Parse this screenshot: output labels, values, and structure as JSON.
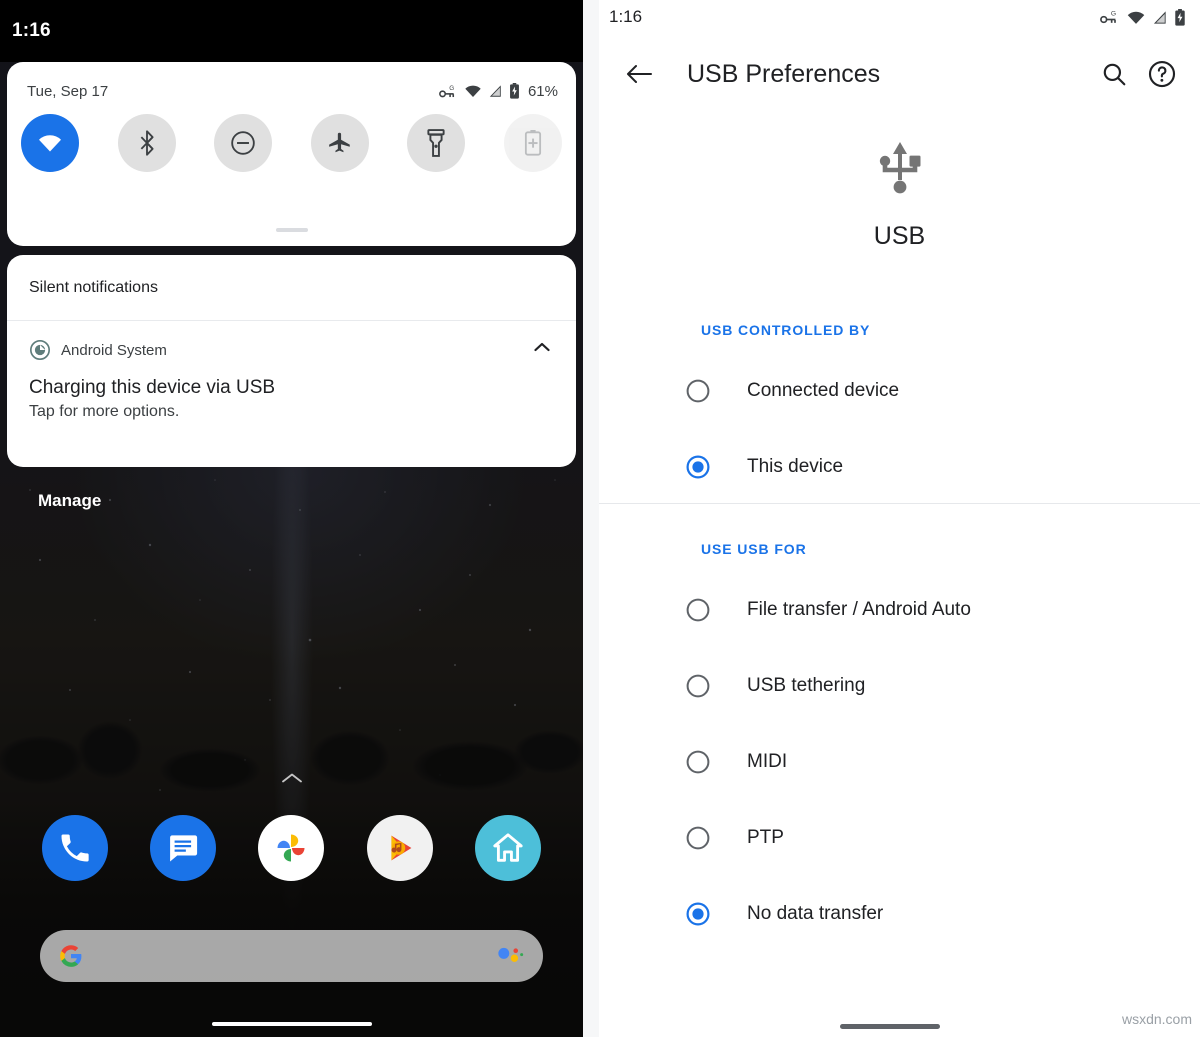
{
  "left_phone": {
    "status_bar": {
      "clock": "1:16",
      "icons": [
        "vpn-key-g-icon",
        "wifi-icon",
        "cell-signal-icon",
        "battery-charging-icon"
      ]
    },
    "quick_settings": {
      "date": "Tue, Sep 17",
      "battery_percent": "61%",
      "status_icons": [
        "vpn-key-g-icon",
        "wifi-icon",
        "cell-signal-icon",
        "battery-charging-icon"
      ],
      "tiles": [
        {
          "name": "wifi",
          "label": "Wi-Fi",
          "icon": "wifi-icon",
          "state": "on"
        },
        {
          "name": "bluetooth",
          "label": "Bluetooth",
          "icon": "bluetooth-icon",
          "state": "off"
        },
        {
          "name": "dnd",
          "label": "Do Not Disturb",
          "icon": "do-not-disturb-icon",
          "state": "off"
        },
        {
          "name": "airplane",
          "label": "Airplane mode",
          "icon": "airplane-icon",
          "state": "off"
        },
        {
          "name": "flashlight",
          "label": "Flashlight",
          "icon": "flashlight-icon",
          "state": "off"
        },
        {
          "name": "battery-saver",
          "label": "Battery Saver",
          "icon": "battery-saver-icon",
          "state": "disabled"
        }
      ]
    },
    "notifications": {
      "section_title": "Silent notifications",
      "items": [
        {
          "app_name": "Android System",
          "app_icon": "android-system-icon",
          "title": "Charging this device via USB",
          "text": "Tap for more options.",
          "collapse_icon": "chevron-up-icon"
        }
      ],
      "manage_label": "Manage"
    },
    "dock": [
      {
        "name": "phone",
        "label": "Phone",
        "color": "#1a73e8"
      },
      {
        "name": "messages",
        "label": "Messages",
        "color": "#1a73e8"
      },
      {
        "name": "photos",
        "label": "Photos",
        "color": "#ffffff"
      },
      {
        "name": "play-music",
        "label": "Play Music",
        "color": "#f1f1f1"
      },
      {
        "name": "google-home",
        "label": "Google Home",
        "color": "#4dbfd9"
      }
    ],
    "search_bar": {
      "google_logo": "google-g-icon",
      "assistant_icon": "google-assistant-icon",
      "placeholder": ""
    }
  },
  "right_settings": {
    "status_bar": {
      "clock": "1:16",
      "icons": [
        "vpn-key-g-icon",
        "wifi-icon",
        "cell-signal-icon",
        "battery-charging-icon"
      ]
    },
    "toolbar": {
      "back_icon": "arrow-back-icon",
      "title": "USB Preferences",
      "search_icon": "search-icon",
      "help_icon": "help-circle-icon"
    },
    "hero": {
      "icon": "usb-icon",
      "label": "USB"
    },
    "sections": [
      {
        "header": "USB CONTROLLED BY",
        "options": [
          {
            "label": "Connected device",
            "selected": false
          },
          {
            "label": "This device",
            "selected": true
          }
        ]
      },
      {
        "header": "USE USB FOR",
        "options": [
          {
            "label": "File transfer / Android Auto",
            "selected": false
          },
          {
            "label": "USB tethering",
            "selected": false
          },
          {
            "label": "MIDI",
            "selected": false
          },
          {
            "label": "PTP",
            "selected": false
          },
          {
            "label": "No data transfer",
            "selected": true
          }
        ]
      }
    ]
  },
  "watermark": "wsxdn.com",
  "colors": {
    "accent_blue": "#1a73e8",
    "text_primary": "#202124",
    "text_secondary": "#3c4043",
    "tile_off": "#e0e0e0",
    "divider": "#e6e8eb"
  }
}
